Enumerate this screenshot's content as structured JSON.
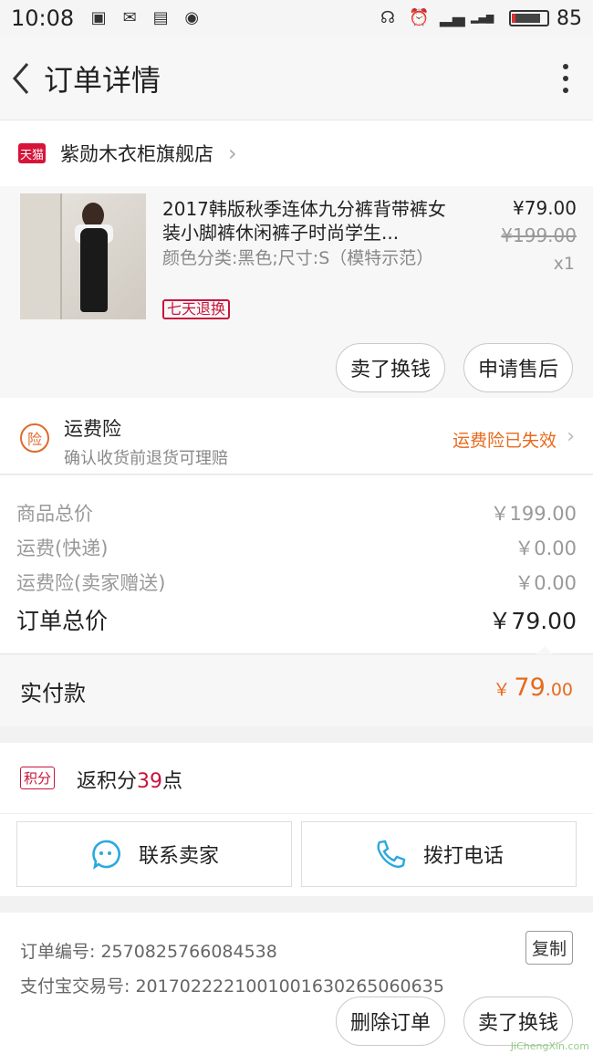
{
  "status_bar": {
    "time": "10:08",
    "battery": "85",
    "network": "4G"
  },
  "nav": {
    "title": "订单详情"
  },
  "shop": {
    "badge": "天猫",
    "name": "紫勋木衣柜旗舰店"
  },
  "item": {
    "title": "2017韩版秋季连体九分裤背带裤女装小脚裤休闲裤子时尚学生...",
    "spec": "颜色分类:黑色;尺寸:S（模特示范）",
    "badge": "七天退换",
    "price_now": "¥79.00",
    "price_old": "¥199.00",
    "quantity": "x1",
    "btn_sell": "卖了换钱",
    "btn_aftersale": "申请售后"
  },
  "insurance": {
    "icon_text": "险",
    "title": "运费险",
    "subtitle": "确认收货前退货可理赔",
    "status": "运费险已失效"
  },
  "summary": {
    "rows": [
      {
        "label": "商品总价",
        "value": "￥199.00"
      },
      {
        "label": "运费(快递)",
        "value": "￥0.00"
      },
      {
        "label": "运费险(卖家赠送)",
        "value": "￥0.00"
      }
    ],
    "total_label": "订单总价",
    "total_value": "￥79.00"
  },
  "paid": {
    "label": "实付款",
    "currency": "￥",
    "integer": "79",
    "decimal": ".00"
  },
  "points": {
    "tag": "积分",
    "prefix": "返积分",
    "number": "39",
    "suffix": "点"
  },
  "contact": {
    "seller": "联系卖家",
    "phone": "拨打电话"
  },
  "order_info": {
    "order_no": "订单编号: 2570825766084538",
    "copy": "复制",
    "alipay_no": "支付宝交易号: 2017022221001001630265060635"
  },
  "bottom": {
    "delete": "删除订单",
    "sell": "卖了换钱"
  },
  "watermark": "JiChengXin.com",
  "colors": {
    "accent": "#e86a1c",
    "tmall_red": "#d7143a",
    "icon_blue": "#2aa8e0"
  }
}
